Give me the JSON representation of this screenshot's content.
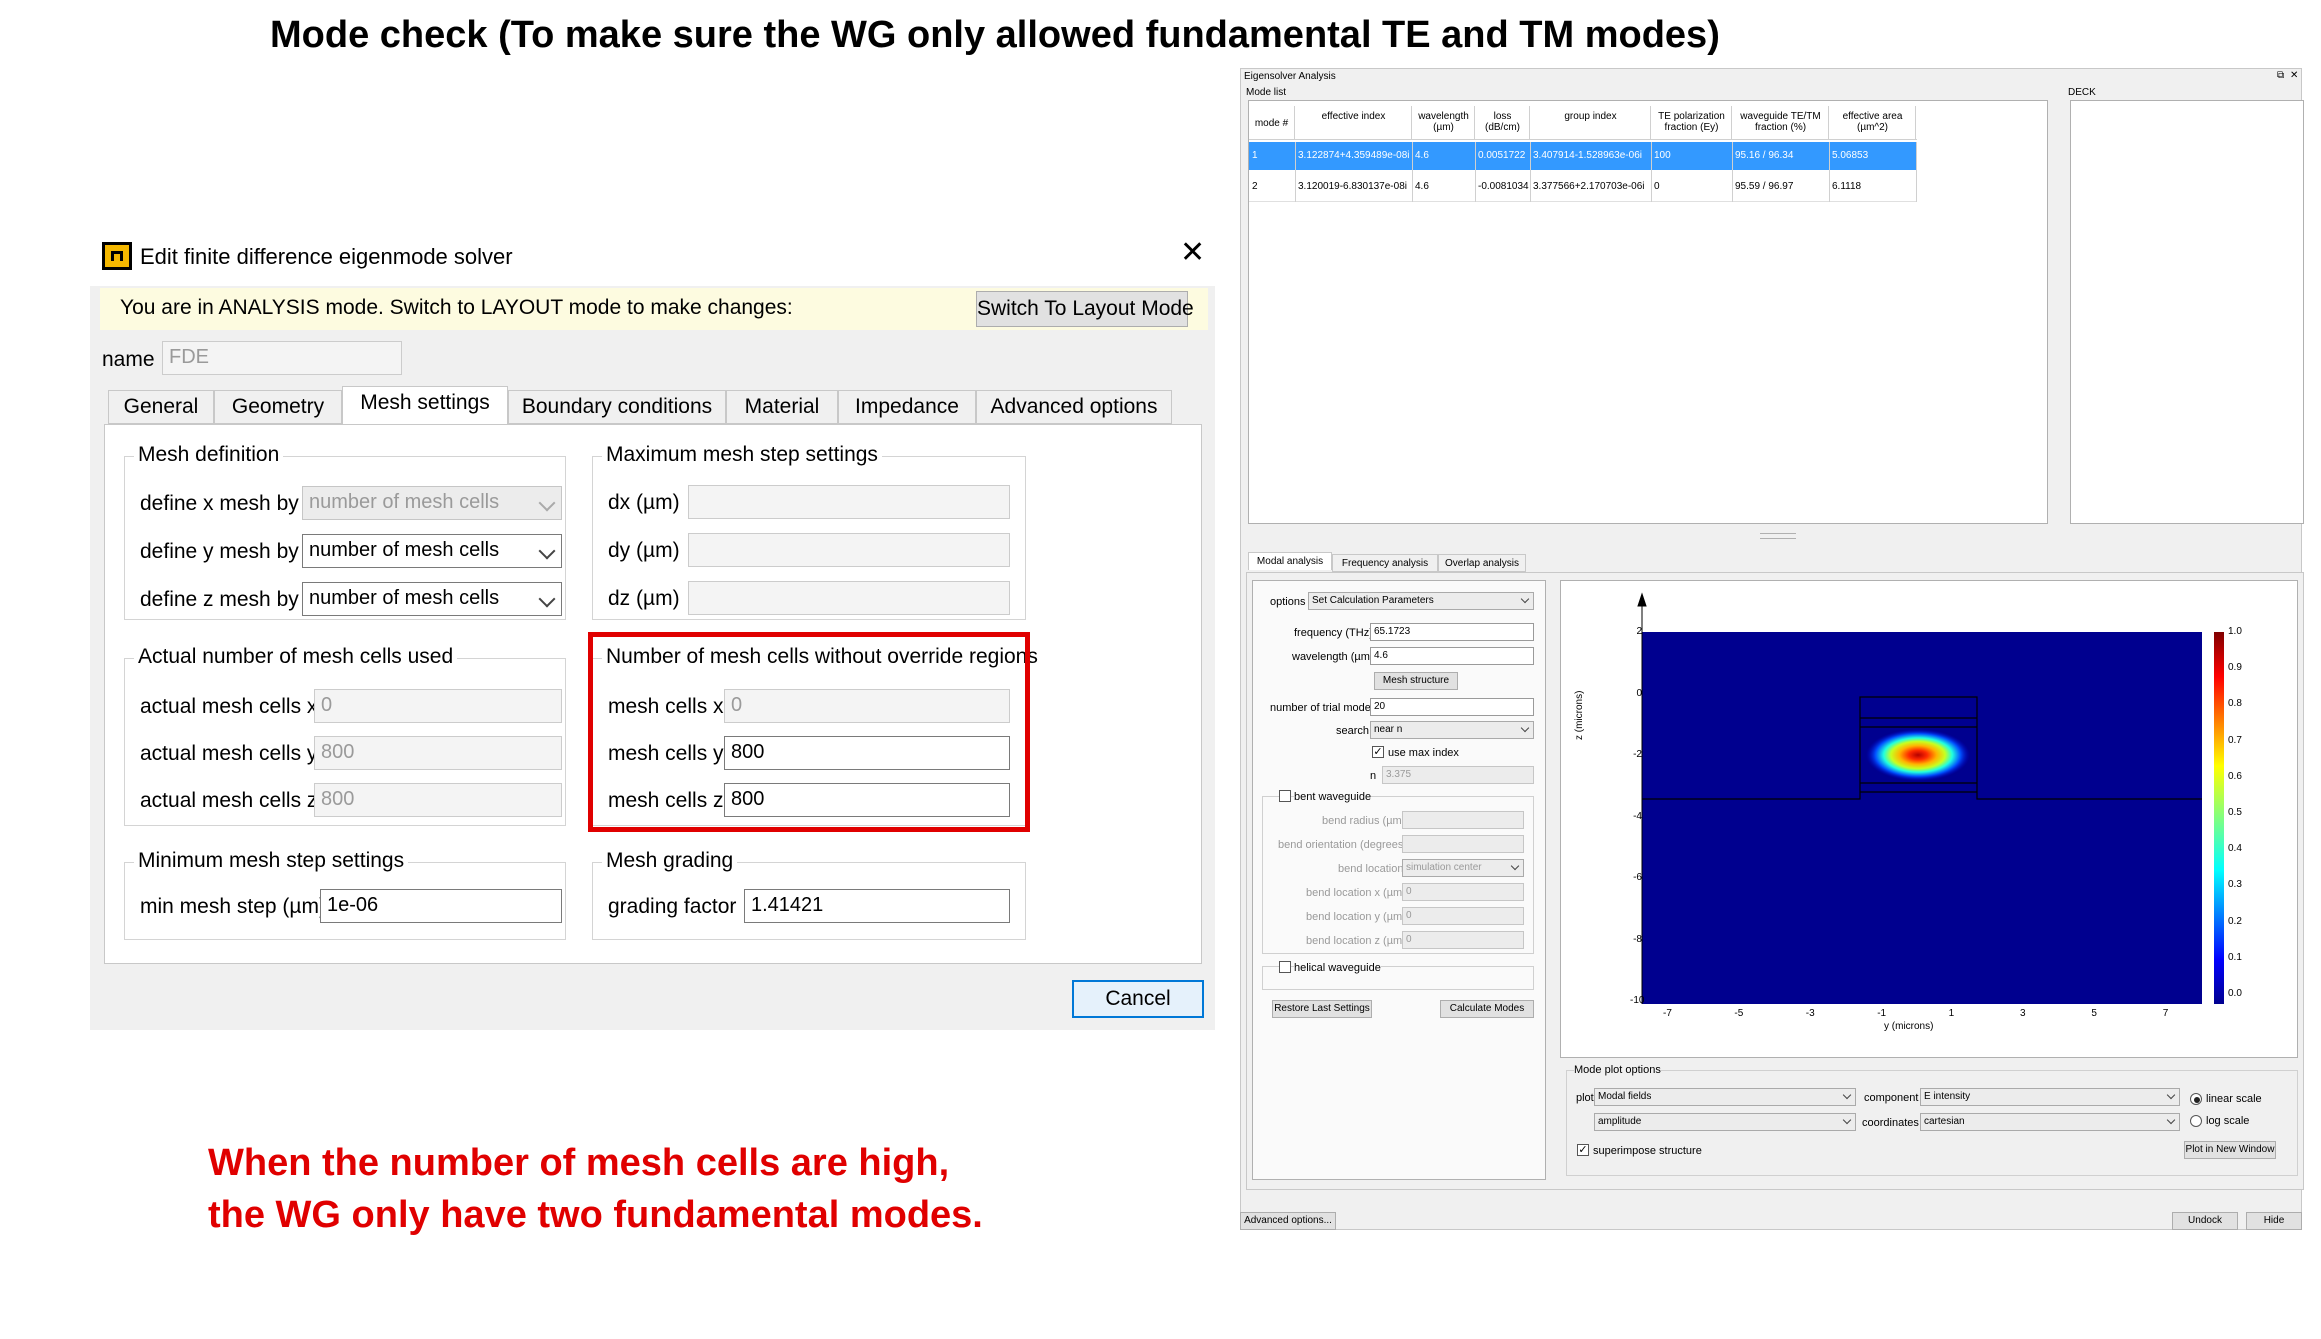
{
  "slide": {
    "title": "Mode check  (To make sure the WG only allowed fundamental TE and TM modes)",
    "note_line1": "When the number of mesh cells are high,",
    "note_line2": "the WG only have two fundamental modes."
  },
  "dialog": {
    "title": "Edit finite difference eigenmode solver",
    "close_glyph": "✕",
    "banner": "You are in ANALYSIS mode.  Switch to LAYOUT mode to make changes:",
    "switch_button": "Switch To Layout Mode",
    "name_label": "name",
    "name_value": "FDE",
    "tabs": [
      "General",
      "Geometry",
      "Mesh settings",
      "Boundary conditions",
      "Material",
      "Impedance",
      "Advanced options"
    ],
    "active_tab": "Mesh settings",
    "mesh_definition": {
      "title": "Mesh definition",
      "x_label": "define x mesh by",
      "x_value": "number of mesh cells",
      "y_label": "define y mesh by",
      "y_value": "number of mesh cells",
      "z_label": "define z mesh by",
      "z_value": "number of mesh cells"
    },
    "max_step": {
      "title": "Maximum mesh step settings",
      "dx_label": "dx (µm)",
      "dy_label": "dy (µm)",
      "dz_label": "dz (µm)"
    },
    "actual_cells": {
      "title": "Actual number of mesh cells used",
      "x_label": "actual mesh cells x",
      "x_value": "0",
      "y_label": "actual mesh cells y",
      "y_value": "800",
      "z_label": "actual mesh cells z",
      "z_value": "800"
    },
    "no_override": {
      "title": "Number of mesh cells without override regions",
      "x_label": "mesh cells x",
      "x_value": "0",
      "y_label": "mesh cells y",
      "y_value": "800",
      "z_label": "mesh cells z",
      "z_value": "800"
    },
    "min_step": {
      "title": "Minimum mesh step settings",
      "label": "min mesh step (µm)",
      "value": "1e-06"
    },
    "grading": {
      "title": "Mesh grading",
      "label": "grading factor",
      "value": "1.41421"
    },
    "cancel_button": "Cancel"
  },
  "eigen": {
    "title": "Eigensolver Analysis",
    "mode_list_label": "Mode list",
    "deck_label": "DECK",
    "columns": [
      "mode #",
      "effective index",
      "wavelength (µm)",
      "loss (dB/cm)",
      "group index",
      "TE polarization fraction (Ey)",
      "waveguide TE/TM fraction (%)",
      "effective area (µm^2)"
    ],
    "rows": [
      [
        "1",
        "3.122874+4.359489e-08i",
        "4.6",
        "0.0051722",
        "3.407914-1.528963e-06i",
        "100",
        "95.16 / 96.34",
        "5.06853"
      ],
      [
        "2",
        "3.120019-6.830137e-08i",
        "4.6",
        "-0.0081034",
        "3.377566+2.170703e-06i",
        "0",
        "95.59 / 96.97",
        "6.1118"
      ]
    ],
    "tabs": [
      "Modal analysis",
      "Frequency analysis",
      "Overlap analysis"
    ],
    "options_label": "options",
    "options_value": "Set Calculation Parameters",
    "frequency_label": "frequency (THz)",
    "frequency_value": "65.1723",
    "wavelength_label": "wavelength (µm)",
    "wavelength_value": "4.6",
    "mesh_structure_button": "Mesh structure",
    "trial_modes_label": "number of trial modes",
    "trial_modes_value": "20",
    "search_label": "search",
    "search_value": "near n",
    "use_max_index_label": "use max index",
    "use_max_index_check": "✓",
    "n_label": "n",
    "n_value": "3.375",
    "bent_waveguide_label": "bent waveguide",
    "bend_radius_label": "bend radius (µm)",
    "bend_orientation_label": "bend orientation (degrees)",
    "bend_location_label": "bend location",
    "bend_location_value": "simulation center",
    "bend_loc_x_label": "bend location x (µm)",
    "bend_loc_x_value": "0",
    "bend_loc_y_label": "bend location y (µm)",
    "bend_loc_y_value": "0",
    "bend_loc_z_label": "bend location z (µm)",
    "bend_loc_z_value": "0",
    "helical_label": "helical waveguide",
    "restore_button": "Restore Last Settings",
    "calculate_button": "Calculate Modes",
    "plot": {
      "y_axis_label": "z (microns)",
      "x_axis_label": "y (microns)",
      "y_ticks": [
        "2",
        "0",
        "-2",
        "-4",
        "-6",
        "-8",
        "-10"
      ],
      "x_ticks": [
        "-7",
        "-5",
        "-3",
        "-1",
        "1",
        "3",
        "5",
        "7"
      ],
      "colorbar_ticks": [
        "1.0",
        "0.9",
        "0.8",
        "0.7",
        "0.6",
        "0.5",
        "0.4",
        "0.3",
        "0.2",
        "0.1",
        "0.0"
      ]
    },
    "mode_plot_options_label": "Mode plot options",
    "plot_label": "plot",
    "plot_value": "Modal fields",
    "amplitude_value": "amplitude",
    "component_label": "component",
    "component_value": "E intensity",
    "coordinates_label": "coordinates",
    "coordinates_value": "cartesian",
    "linear_scale_label": "linear scale",
    "log_scale_label": "log scale",
    "superimpose_label": "superimpose structure",
    "superimpose_check": "✓",
    "plot_new_window_button": "Plot in New Window",
    "advanced_button": "Advanced options...",
    "undock_button": "Undock",
    "hide_button": "Hide"
  }
}
